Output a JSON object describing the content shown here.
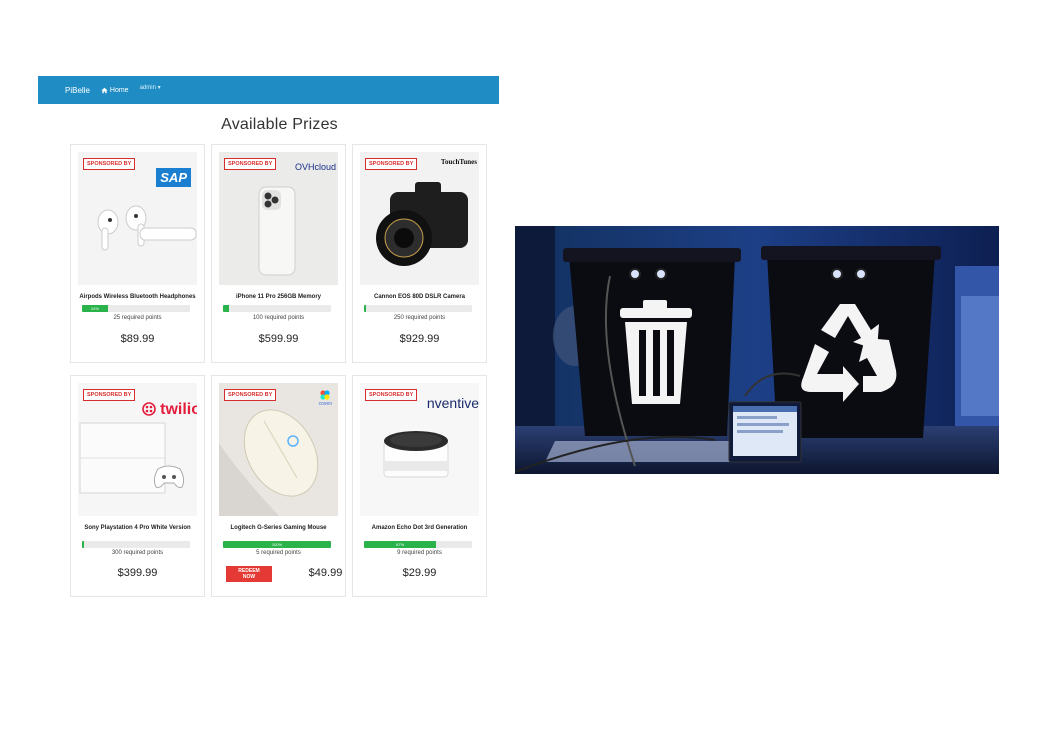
{
  "navbar": {
    "brand": "PiBelle",
    "home_label": "Home",
    "user_label": "admin ▾"
  },
  "page_title": "Available Prizes",
  "sponsor_label": "SPONSORED BY",
  "prizes": [
    {
      "name": "Airpods Wireless Bluetooth Headphones",
      "progress": 0.24,
      "progress_label": "24%",
      "points": "25 required points",
      "price": "$89.99",
      "sponsor": "SAP"
    },
    {
      "name": "iPhone 11 Pro 256GB Memory",
      "progress": 0.06,
      "progress_label": "",
      "points": "100 required points",
      "price": "$599.99",
      "sponsor": "OVHcloud"
    },
    {
      "name": "Cannon EOS 80D DSLR Camera",
      "progress": 0.02,
      "progress_label": "",
      "points": "250 required points",
      "price": "$929.99",
      "sponsor": "TouchTunes"
    },
    {
      "name": "Sony Playstation 4 Pro White Version",
      "progress": 0.01,
      "progress_label": "",
      "points": "300 required points",
      "price": "$399.99",
      "sponsor": "twilio"
    },
    {
      "name": "Logitech G-Series Gaming Mouse",
      "progress": 1.0,
      "progress_label": "100%",
      "points": "5 required points",
      "price": "$49.99",
      "sponsor": "coveo",
      "redeem_label": "REDEEM NOW"
    },
    {
      "name": "Amazon Echo Dot 3rd Generation",
      "progress": 0.67,
      "progress_label": "67%",
      "points": "9 required points",
      "price": "$29.99",
      "sponsor": "nventive"
    }
  ],
  "photo": {
    "left_bin_icon": "trash-can-icon",
    "right_bin_icon": "recycle-icon"
  },
  "colors": {
    "navbar": "#1f8dc3",
    "sponsor_red": "#d92d2d",
    "progress_green": "#29b34a",
    "redeem_red": "#e53935"
  }
}
